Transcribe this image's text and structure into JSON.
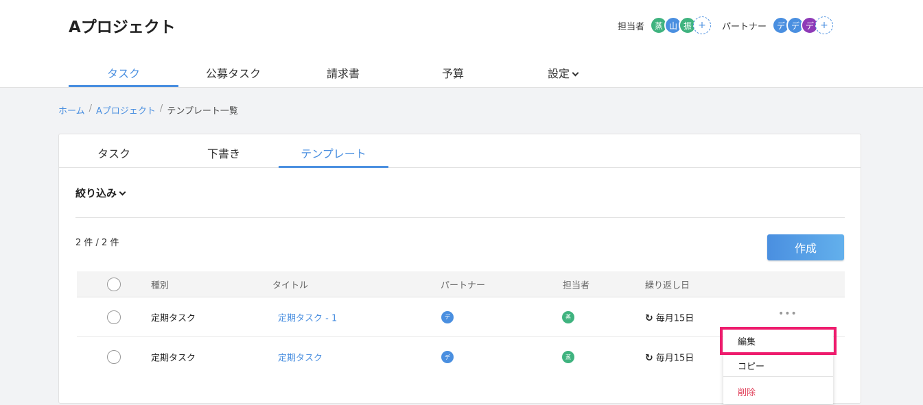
{
  "project": {
    "title": "Aプロジェクト"
  },
  "members": {
    "assignee_label": "担当者",
    "assignees": [
      {
        "initial": "蒸",
        "color": "#3fb37f"
      },
      {
        "initial": "山",
        "color": "#4a8fe0"
      },
      {
        "initial": "振",
        "color": "#3fb37f"
      }
    ],
    "partner_label": "パートナー",
    "partners": [
      {
        "initial": "デ",
        "color": "#4a8fe0"
      },
      {
        "initial": "デ",
        "color": "#4a8fe0"
      },
      {
        "initial": "デ",
        "color": "#8e3ab7"
      }
    ],
    "add_symbol": "+"
  },
  "nav": {
    "tabs": [
      "タスク",
      "公募タスク",
      "請求書",
      "予算",
      "設定"
    ],
    "active": 0
  },
  "breadcrumb": {
    "home": "ホーム",
    "project": "Aプロジェクト",
    "current": "テンプレート一覧",
    "sep": "/"
  },
  "content_tabs": {
    "tabs": [
      "タスク",
      "下書き",
      "テンプレート"
    ],
    "active": 2
  },
  "filter": {
    "label": "絞り込み"
  },
  "count": "2 件 / 2 件",
  "create_button": "作成",
  "table": {
    "headers": {
      "type": "種別",
      "title": "タイトル",
      "partner": "パートナー",
      "assignee": "担当者",
      "repeat": "繰り返し日"
    },
    "rows": [
      {
        "type": "定期タスク",
        "title": "定期タスク - 1",
        "partner": "デ",
        "assignee": "蒸",
        "repeat": "毎月15日",
        "more": "•••"
      },
      {
        "type": "定期タスク",
        "title": "定期タスク",
        "partner": "デ",
        "assignee": "蒸",
        "repeat": "毎月15日"
      }
    ]
  },
  "context_menu": {
    "edit": "編集",
    "copy": "コピー",
    "delete": "削除"
  },
  "colors": {
    "accent": "#4a8fe0",
    "highlight": "#ee1c6d",
    "danger": "#e0405a",
    "assignee_avatar": "#3fb37f",
    "partner_avatar": "#4a8fe0"
  }
}
